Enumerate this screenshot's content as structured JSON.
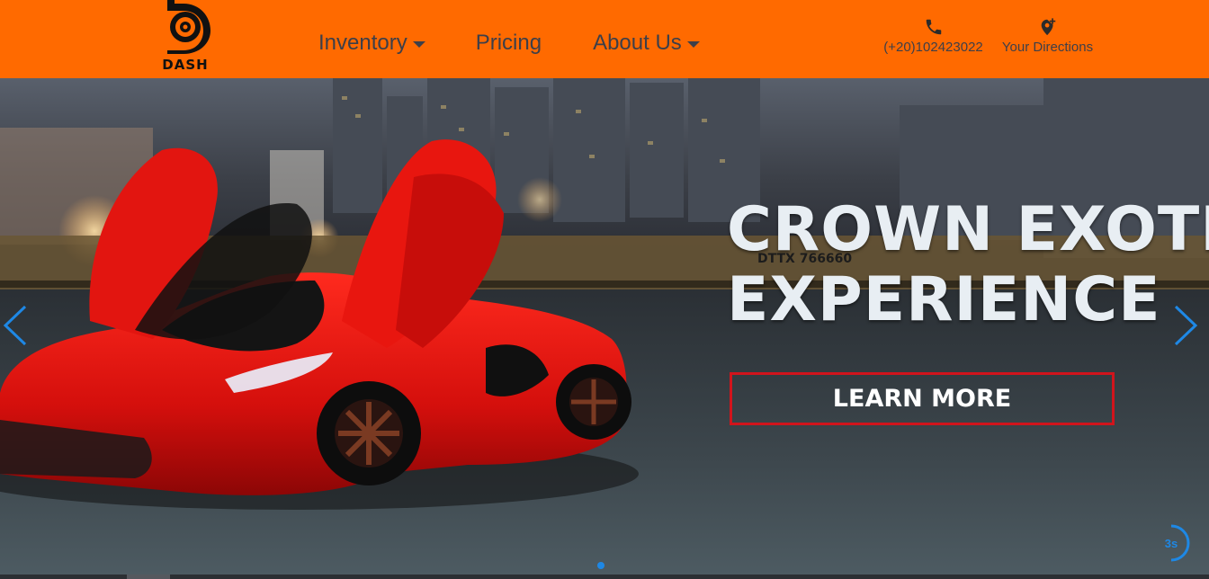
{
  "brand": {
    "name": "DASH",
    "accent_color": "#ff6a00"
  },
  "nav": {
    "items": [
      {
        "label": "Inventory",
        "dropdown": true
      },
      {
        "label": "Pricing",
        "dropdown": false
      },
      {
        "label": "About Us",
        "dropdown": true
      }
    ]
  },
  "contact": {
    "phone": {
      "icon": "phone-icon",
      "label": "(+20)102423022"
    },
    "directions": {
      "icon": "add-location-icon",
      "label": "Your Directions"
    }
  },
  "hero": {
    "title_line1": "CROWN EXOTIC",
    "title_line2": "EXPERIENCE",
    "cta_label": "LEARN MORE",
    "cta_border_color": "#d1141c",
    "prev_icon": "chevron-left-icon",
    "next_icon": "chevron-right-icon",
    "autoplay_label": "3s",
    "indicator_color": "#1e88e5"
  }
}
